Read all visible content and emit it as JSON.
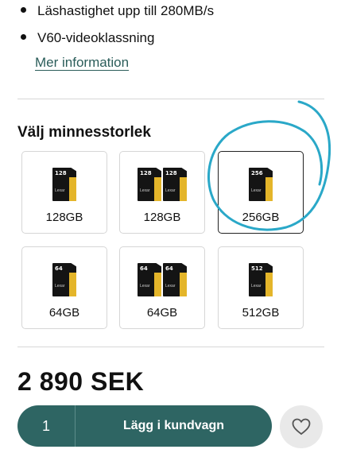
{
  "bullets": [
    "Läshastighet upp till 280MB/s",
    "V60-videoklassning"
  ],
  "more_link": "Mer information",
  "section_title": "Välj minnesstorlek",
  "options": [
    {
      "label": "128GB",
      "card_text": "128",
      "cards": 1,
      "selected": false
    },
    {
      "label": "128GB",
      "card_text": "128",
      "cards": 2,
      "selected": false
    },
    {
      "label": "256GB",
      "card_text": "256",
      "cards": 1,
      "selected": true
    },
    {
      "label": "64GB",
      "card_text": "64",
      "cards": 1,
      "selected": false
    },
    {
      "label": "64GB",
      "card_text": "64",
      "cards": 2,
      "selected": false
    },
    {
      "label": "512GB",
      "card_text": "512",
      "cards": 1,
      "selected": false
    }
  ],
  "card_brand": "Lexar",
  "price": "2 890 SEK",
  "cart": {
    "quantity": "1",
    "button_label": "Lägg i kundvagn"
  },
  "wishlist_icon": "heart-icon",
  "colors": {
    "accent": "#2e6563",
    "link": "#2b5d5a",
    "card_stripe": "#e4b52a",
    "annotation": "#2aa8c8"
  }
}
